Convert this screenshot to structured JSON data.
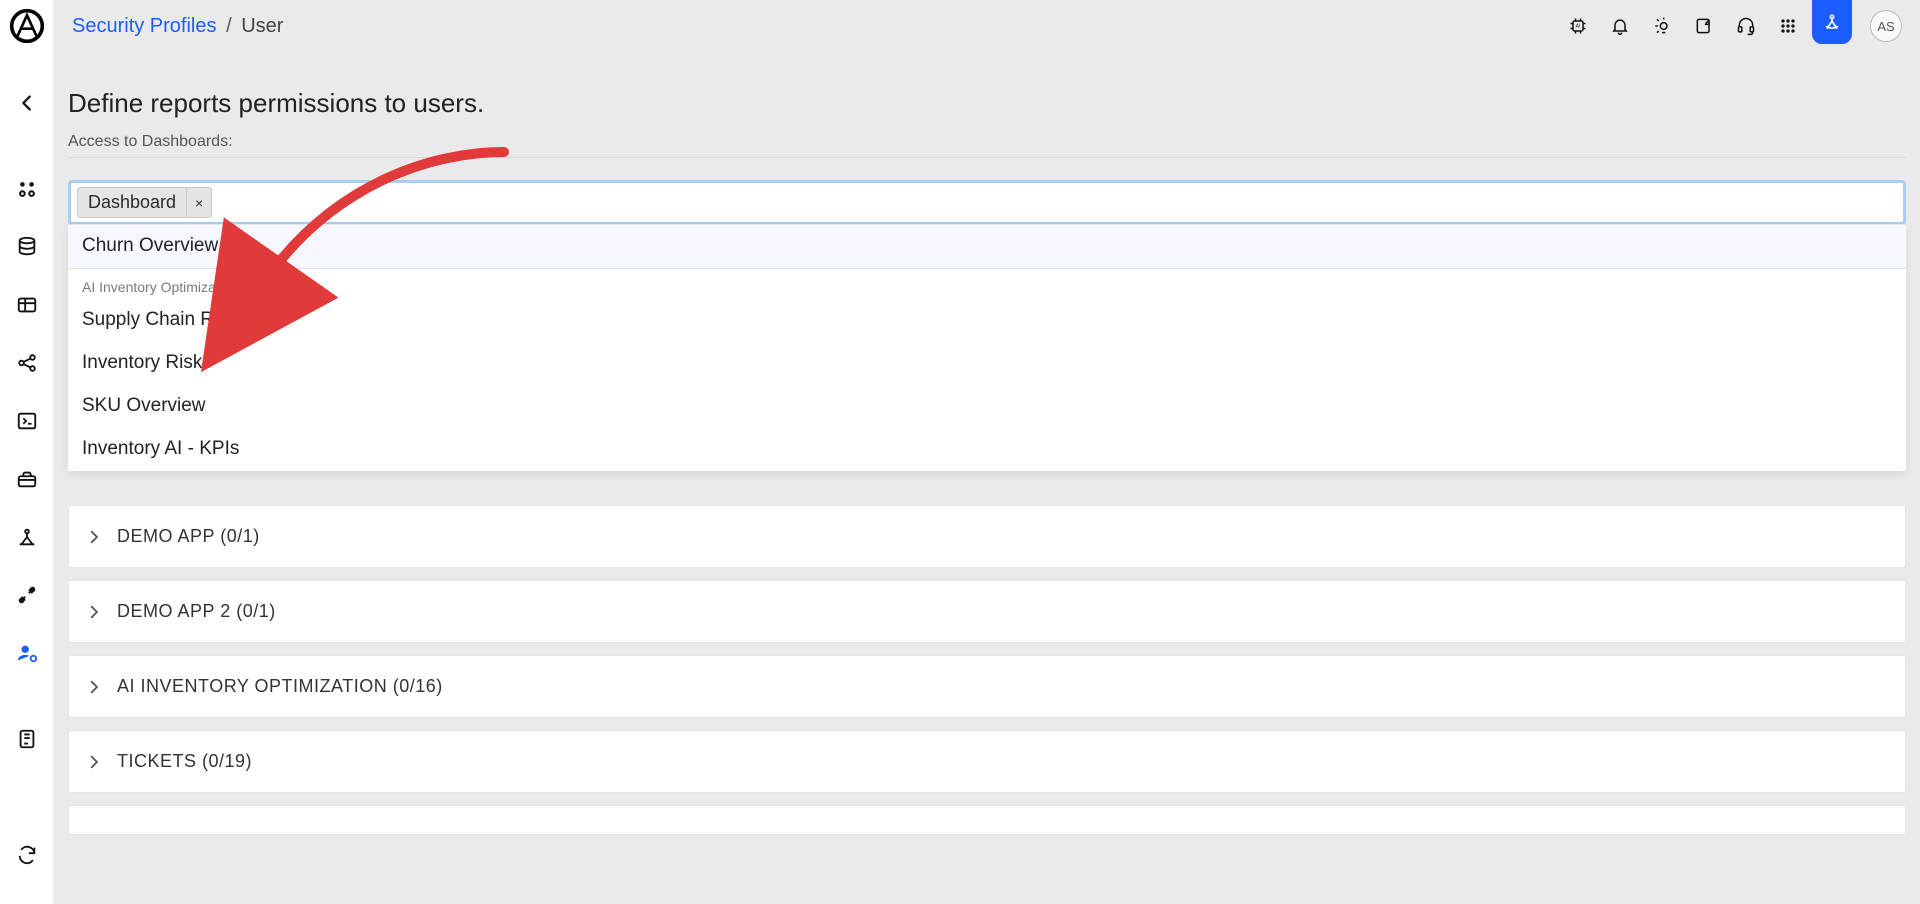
{
  "breadcrumb": {
    "link": "Security Profiles",
    "sep": "/",
    "current": "User"
  },
  "topbar": {
    "avatar_initials": "AS"
  },
  "page": {
    "title": "Define reports permissions to users.",
    "field_label": "Access to Dashboards:"
  },
  "multiselect": {
    "chip_label": "Dashboard",
    "chip_close": "×"
  },
  "dropdown": {
    "items_flat": [
      {
        "label": "Churn Overview",
        "highlight": true
      }
    ],
    "group_label": "AI Inventory Optimization",
    "group_items": [
      "Supply Chain Risks",
      "Inventory Risks",
      "SKU Overview",
      "Inventory AI - KPIs"
    ]
  },
  "accordions": [
    "DEMO APP (0/1)",
    "DEMO APP 2 (0/1)",
    "AI INVENTORY OPTIMIZATION (0/16)",
    "TICKETS (0/19)"
  ],
  "colors": {
    "accent": "#1b5dff",
    "annotation": "#e03a3a"
  }
}
